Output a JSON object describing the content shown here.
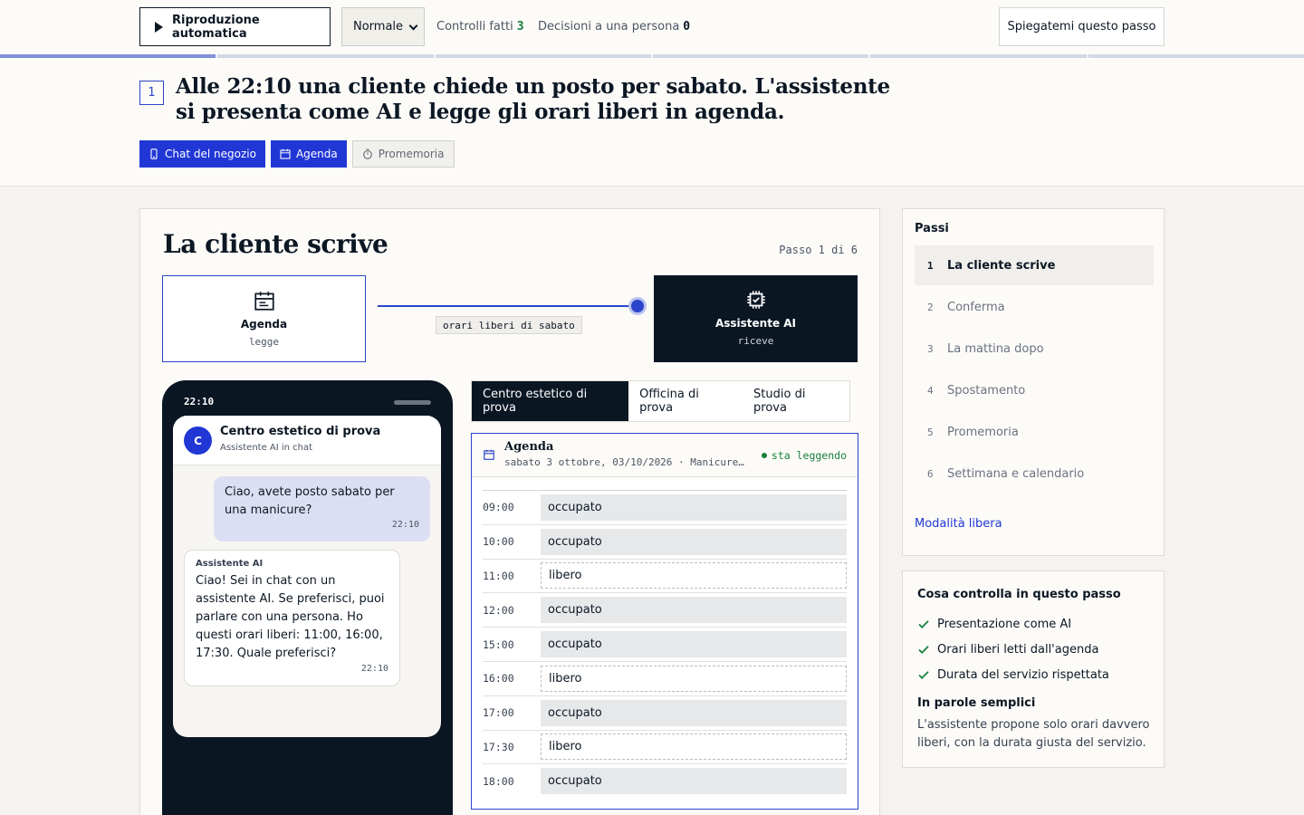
{
  "toolbar": {
    "autoplay_label": "Riproduzione automatica",
    "speed_value": "Normale",
    "checks_label": "Controlli fatti",
    "checks_count": "3",
    "human_label": "Decisioni a una persona",
    "human_count": "0",
    "explain_label": "Spiegatemi questo passo"
  },
  "progress": {
    "current_step": 1,
    "total_steps": 6
  },
  "header": {
    "step_number": "1",
    "headline": "Alle 22:10 una cliente chiede un posto per sabato. L'assistente si presenta come AI e legge gli orari liberi in agenda.",
    "channels": [
      {
        "label": "Chat del negozio",
        "active": true,
        "icon": "phone-icon"
      },
      {
        "label": "Agenda",
        "active": true,
        "icon": "calendar-icon"
      },
      {
        "label": "Promemoria",
        "active": false,
        "icon": "timer-icon"
      }
    ]
  },
  "scene": {
    "title": "La cliente scrive",
    "step_counter": "Passo 1 di 6",
    "flow": {
      "source": {
        "name": "Agenda",
        "verb": "legge",
        "icon": "calendar-icon"
      },
      "target": {
        "name": "Assistente AI",
        "verb": "riceve",
        "icon": "chip-icon"
      },
      "label": "orari liberi di sabato"
    }
  },
  "phone": {
    "time": "22:10",
    "contact_initial": "C",
    "contact_name": "Centro estetico di prova",
    "contact_sub": "Assistente AI in chat",
    "messages": [
      {
        "text": "Ciao, avete posto sabato per una manicure?",
        "time": "22:10"
      },
      {
        "sender": "Assistente AI",
        "text": "Ciao! Sei in chat con un assistente AI. Se preferisci, puoi parlare con una persona. Ho questi orari liberi: 11:00, 16:00, 17:30. Quale preferisci?",
        "time": "22:10"
      }
    ]
  },
  "business_tabs": [
    "Centro estetico di prova",
    "Officina di prova",
    "Studio di prova"
  ],
  "agenda": {
    "title": "Agenda",
    "subtitle": "sabato 3 ottobre, 03/10/2026 · Manicure…",
    "status": "sta leggendo",
    "slots": [
      {
        "time": "09:00",
        "state": "occupato",
        "free": false
      },
      {
        "time": "10:00",
        "state": "occupato",
        "free": false
      },
      {
        "time": "11:00",
        "state": "libero",
        "free": true
      },
      {
        "time": "12:00",
        "state": "occupato",
        "free": false
      },
      {
        "time": "15:00",
        "state": "occupato",
        "free": false
      },
      {
        "time": "16:00",
        "state": "libero",
        "free": true
      },
      {
        "time": "17:00",
        "state": "occupato",
        "free": false
      },
      {
        "time": "17:30",
        "state": "libero",
        "free": true
      },
      {
        "time": "18:00",
        "state": "occupato",
        "free": false
      }
    ]
  },
  "steps": {
    "title": "Passi",
    "items": [
      {
        "n": "1",
        "label": "La cliente scrive"
      },
      {
        "n": "2",
        "label": "Conferma"
      },
      {
        "n": "3",
        "label": "La mattina dopo"
      },
      {
        "n": "4",
        "label": "Spostamento"
      },
      {
        "n": "5",
        "label": "Promemoria"
      },
      {
        "n": "6",
        "label": "Settimana e calendario"
      }
    ],
    "free_mode_link": "Modalità libera"
  },
  "checks": {
    "title": "Cosa controlla in questo passo",
    "items": [
      "Presentazione come AI",
      "Orari liberi letti dall'agenda",
      "Durata del servizio rispettata"
    ],
    "plain_title": "In parole semplici",
    "plain_text": "L'assistente propone solo orari davvero liberi, con la durata giusta del servizio."
  },
  "colors": {
    "accent": "#2037d6",
    "dark": "#0b1623",
    "success": "#17803d",
    "background": "#f4f3ef"
  }
}
